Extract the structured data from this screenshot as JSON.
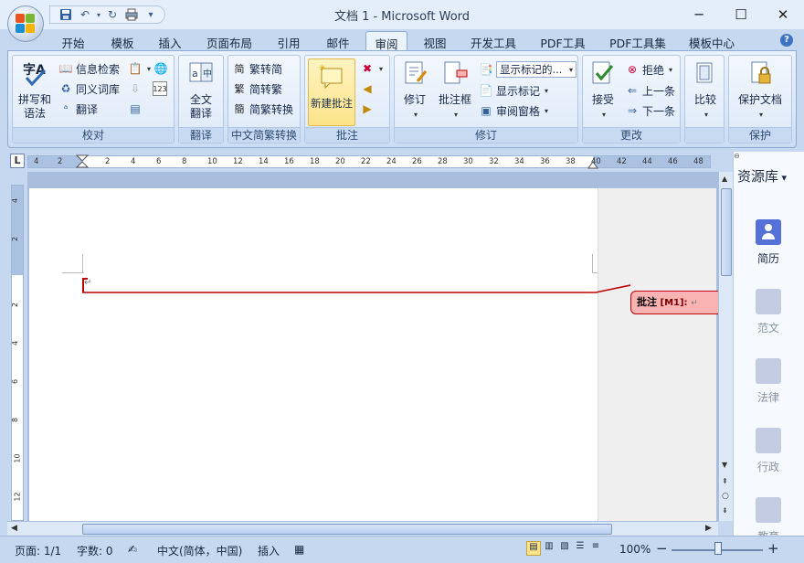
{
  "window": {
    "title": "文档 1 - Microsoft Word",
    "minimize": "─",
    "maximize": "☐",
    "close": "✕"
  },
  "qat_more": "▾",
  "tabs": [
    "开始",
    "模板",
    "插入",
    "页面布局",
    "引用",
    "邮件",
    "审阅",
    "视图",
    "开发工具",
    "PDF工具",
    "PDF工具集",
    "模板中心"
  ],
  "active_tab": "审阅",
  "help": "?",
  "ribbon": {
    "proofing": {
      "label": "校对",
      "spell": "拼写和语法",
      "research": "信息检索",
      "thesaurus": "同义词库",
      "translate": "翻译"
    },
    "translate": {
      "label": "翻译",
      "full_translate": "全文翻译"
    },
    "chinese_convert": {
      "label": "中文简繁转换",
      "to_simplified": "繁转简",
      "to_traditional": "简转繁",
      "convert": "简繁转换"
    },
    "comments": {
      "label": "批注",
      "new_comment": "新建批注"
    },
    "tracking": {
      "label": "修订",
      "track_changes": "修订",
      "balloons": "批注框",
      "display_select": "显示标记的...",
      "show_markup": "显示标记",
      "reviewing_pane": "审阅窗格"
    },
    "changes": {
      "label": "更改",
      "accept": "接受",
      "reject": "拒绝",
      "previous": "上一条",
      "next": "下一条"
    },
    "compare": {
      "label": "",
      "compare": "比较"
    },
    "protect": {
      "label": "保护",
      "protect_doc": "保护文档"
    }
  },
  "ruler": {
    "corner": "L",
    "ticks": [
      "4",
      "2",
      "2",
      "4",
      "6",
      "8",
      "10",
      "12",
      "14",
      "16",
      "18",
      "20",
      "22",
      "24",
      "26",
      "28",
      "30",
      "32",
      "34",
      "36",
      "38",
      "40",
      "42",
      "44",
      "46",
      "48"
    ],
    "vticks": [
      "4",
      "2",
      "2",
      "4",
      "6",
      "8",
      "10",
      "12"
    ]
  },
  "document": {
    "comment_label": "批注",
    "comment_id": "[M1]:",
    "para_mark": "↵"
  },
  "right_panel": {
    "title": "资源库",
    "items": [
      "简历",
      "范文",
      "法律",
      "行政",
      "教育"
    ]
  },
  "status": {
    "page": "页面: 1/1",
    "words": "字数: 0",
    "language": "中文(简体，中国)",
    "mode": "插入",
    "zoom": "100%",
    "zoom_out": "−",
    "zoom_in": "+"
  },
  "colors": {
    "comment_line": "#c00000",
    "comment_fill": "#f9b3b3",
    "active_group": "#fde48a"
  }
}
